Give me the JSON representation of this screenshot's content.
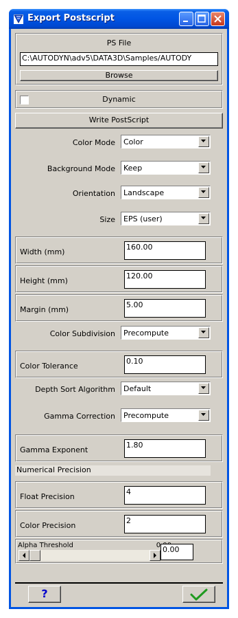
{
  "window": {
    "title": "Export Postscript"
  },
  "ps_file": {
    "heading": "PS File",
    "path": "C:\\AUTODYN\\adv5\\DATA3D\\Samples/AUTODY",
    "browse_label": "Browse"
  },
  "dynamic": {
    "label": "Dynamic",
    "checked": false
  },
  "write_label": "Write PostScript",
  "dropdowns": {
    "color_mode": {
      "label": "Color Mode",
      "value": "Color"
    },
    "background_mode": {
      "label": "Background Mode",
      "value": "Keep"
    },
    "orientation": {
      "label": "Orientation",
      "value": "Landscape"
    },
    "size": {
      "label": "Size",
      "value": "EPS (user)"
    },
    "color_subdivision": {
      "label": "Color Subdivision",
      "value": "Precompute"
    },
    "depth_sort": {
      "label": "Depth Sort Algorithm",
      "value": "Default"
    },
    "gamma_correction": {
      "label": "Gamma Correction",
      "value": "Precompute"
    }
  },
  "fields": {
    "width": {
      "label": "Width (mm)",
      "value": "160.00"
    },
    "height": {
      "label": "Height (mm)",
      "value": "120.00"
    },
    "margin": {
      "label": "Margin (mm)",
      "value": "5.00"
    },
    "color_tolerance": {
      "label": "Color Tolerance",
      "value": "0.10"
    },
    "gamma_exponent": {
      "label": "Gamma Exponent",
      "value": "1.80"
    },
    "float_precision": {
      "label": "Float Precision",
      "value": "4"
    },
    "color_precision": {
      "label": "Color Precision",
      "value": "2"
    }
  },
  "numerical_precision_heading": "Numerical Precision",
  "alpha_threshold": {
    "label": "Alpha Threshold",
    "readout": "0.00",
    "value": "0.00",
    "level": 0.0
  },
  "footer": {
    "help_label": "?",
    "ok_icon": "checkmark-icon"
  },
  "colors": {
    "titlebar": "#0054e3",
    "face": "#d4d0c8",
    "ok_check": "#1f9a1f",
    "help": "#0000cc"
  }
}
